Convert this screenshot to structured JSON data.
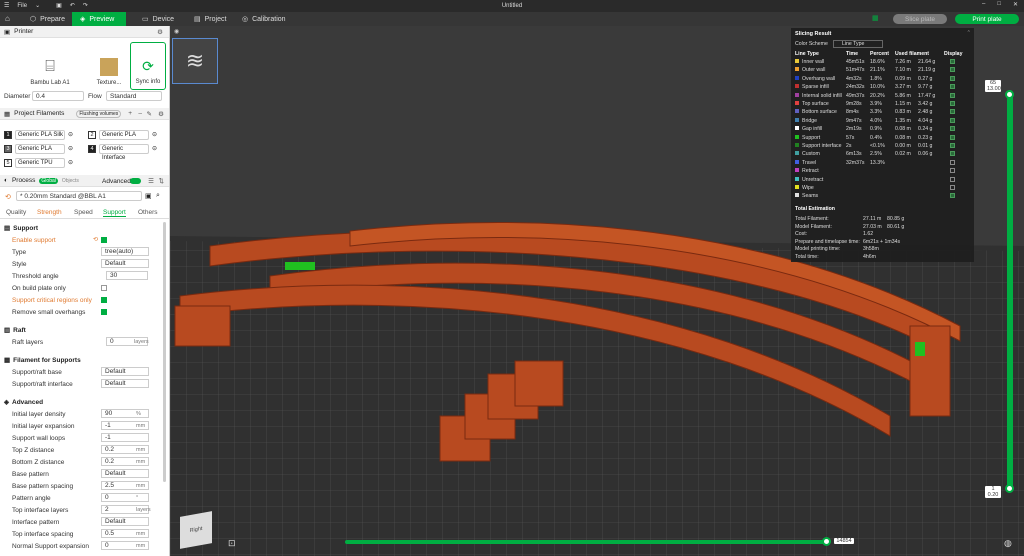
{
  "titlebar": {
    "file_menu": "File",
    "title": "Untitled"
  },
  "nav": {
    "tabs": [
      {
        "label": "Prepare"
      },
      {
        "label": "Preview"
      },
      {
        "label": "Device"
      },
      {
        "label": "Project"
      },
      {
        "label": "Calibration"
      }
    ],
    "slice_label": "Slice plate",
    "print_label": "Print plate"
  },
  "printer": {
    "section": "Printer",
    "printer_name": "Bambu Lab A1",
    "plate_label": "Texture...",
    "sync_label": "Sync info",
    "diameter_label": "Diameter",
    "diameter_value": "0.4",
    "flow_label": "Flow",
    "flow_value": "Standard"
  },
  "filaments": {
    "section": "Project Filaments",
    "flushing": "Flushing volumes",
    "items": [
      {
        "num": "1",
        "name": "Generic PLA Silk"
      },
      {
        "num": "2",
        "name": "Generic PLA"
      },
      {
        "num": "3",
        "name": "Generic PLA"
      },
      {
        "num": "4",
        "name": "Generic Interface"
      },
      {
        "num": "5",
        "name": "Generic TPU"
      }
    ]
  },
  "process": {
    "section": "Process",
    "global_label": "Global",
    "objects_label": "Objects",
    "advanced_label": "Advanced",
    "preset": "* 0.20mm Standard @BBL A1",
    "tabs": [
      "Quality",
      "Strength",
      "Speed",
      "Support",
      "Others"
    ]
  },
  "support": {
    "group": "Support",
    "enable": "Enable support",
    "type_label": "Type",
    "type_value": "tree(auto)",
    "style_label": "Style",
    "style_value": "Default",
    "threshold_label": "Threshold angle",
    "threshold_value": "30",
    "build_plate_label": "On build plate only",
    "critical_label": "Support critical regions only",
    "remove_small_label": "Remove small overhangs"
  },
  "raft": {
    "group": "Raft",
    "layers_label": "Raft layers",
    "layers_value": "0",
    "layers_unit": "layers"
  },
  "filament_for_supports": {
    "group": "Filament for Supports",
    "base_label": "Support/raft base",
    "base_value": "Default",
    "iface_label": "Support/raft interface",
    "iface_value": "Default"
  },
  "advanced": {
    "group": "Advanced",
    "rows": [
      {
        "label": "Initial layer density",
        "value": "90",
        "unit": "%"
      },
      {
        "label": "Initial layer expansion",
        "value": "-1",
        "unit": "mm"
      },
      {
        "label": "Support wall loops",
        "value": "-1",
        "unit": ""
      },
      {
        "label": "Top Z distance",
        "value": "0.2",
        "unit": "mm"
      },
      {
        "label": "Bottom Z distance",
        "value": "0.2",
        "unit": "mm"
      },
      {
        "label": "Base pattern",
        "value": "Default",
        "unit": ""
      },
      {
        "label": "Base pattern spacing",
        "value": "2.5",
        "unit": "mm"
      },
      {
        "label": "Pattern angle",
        "value": "0",
        "unit": "°"
      },
      {
        "label": "Top interface layers",
        "value": "2",
        "unit": "layers"
      },
      {
        "label": "Interface pattern",
        "value": "Default",
        "unit": ""
      },
      {
        "label": "Top interface spacing",
        "value": "0.5",
        "unit": "mm"
      },
      {
        "label": "Normal Support expansion",
        "value": "0",
        "unit": "mm"
      }
    ]
  },
  "result": {
    "title": "Slicing Result",
    "scheme_label": "Color Scheme",
    "scheme_value": "Line Type",
    "headers": [
      "Line Type",
      "Time",
      "Percent",
      "Used filament",
      "Display"
    ],
    "rows": [
      {
        "name": "Inner wall",
        "color": "#e8c83a",
        "time": "45m51s",
        "pct": "18.6%",
        "m": "7.26 m",
        "g": "21.64 g",
        "on": true
      },
      {
        "name": "Outer wall",
        "color": "#f0a030",
        "time": "51m47s",
        "pct": "21.1%",
        "m": "7.10 m",
        "g": "21.19 g",
        "on": true
      },
      {
        "name": "Overhang wall",
        "color": "#2040c0",
        "time": "4m32s",
        "pct": "1.8%",
        "m": "0.09 m",
        "g": "0.27 g",
        "on": true
      },
      {
        "name": "Sparse infill",
        "color": "#c03030",
        "time": "24m32s",
        "pct": "10.0%",
        "m": "3.27 m",
        "g": "9.77 g",
        "on": true
      },
      {
        "name": "Internal solid infill",
        "color": "#a040a0",
        "time": "49m37s",
        "pct": "20.2%",
        "m": "5.86 m",
        "g": "17.47 g",
        "on": true
      },
      {
        "name": "Top surface",
        "color": "#e04040",
        "time": "9m28s",
        "pct": "3.9%",
        "m": "1.15 m",
        "g": "3.42 g",
        "on": true
      },
      {
        "name": "Bottom surface",
        "color": "#6060c0",
        "time": "8m4s",
        "pct": "3.3%",
        "m": "0.83 m",
        "g": "2.48 g",
        "on": true
      },
      {
        "name": "Bridge",
        "color": "#4080b0",
        "time": "9m47s",
        "pct": "4.0%",
        "m": "1.35 m",
        "g": "4.04 g",
        "on": true
      },
      {
        "name": "Gap infill",
        "color": "#ffffff",
        "time": "2m19s",
        "pct": "0.9%",
        "m": "0.08 m",
        "g": "0.24 g",
        "on": true
      },
      {
        "name": "Support",
        "color": "#20c020",
        "time": "57s",
        "pct": "0.4%",
        "m": "0.08 m",
        "g": "0.23 g",
        "on": true
      },
      {
        "name": "Support interface",
        "color": "#208020",
        "time": "2s",
        "pct": "<0.1%",
        "m": "0.00 m",
        "g": "0.01 g",
        "on": true
      },
      {
        "name": "Custom",
        "color": "#40a0a0",
        "time": "6m13s",
        "pct": "2.5%",
        "m": "0.02 m",
        "g": "0.06 g",
        "on": true
      },
      {
        "name": "Travel",
        "color": "#4060e0",
        "time": "32m37s",
        "pct": "13.3%",
        "m": "",
        "g": "",
        "on": false
      },
      {
        "name": "Retract",
        "color": "#c040c0",
        "time": "",
        "pct": "",
        "m": "",
        "g": "",
        "on": false
      },
      {
        "name": "Unretract",
        "color": "#40c0c0",
        "time": "",
        "pct": "",
        "m": "",
        "g": "",
        "on": false
      },
      {
        "name": "Wipe",
        "color": "#e0e020",
        "time": "",
        "pct": "",
        "m": "",
        "g": "",
        "on": false
      },
      {
        "name": "Seams",
        "color": "#e0e0e0",
        "time": "",
        "pct": "",
        "m": "",
        "g": "",
        "on": true
      }
    ],
    "total_title": "Total Estimation",
    "totals": [
      {
        "label": "Total Filament:",
        "a": "27.11 m",
        "b": "80.85 g"
      },
      {
        "label": "Model Filament:",
        "a": "27.03 m",
        "b": "80.61 g"
      },
      {
        "label": "Cost:",
        "a": "1.62",
        "b": ""
      },
      {
        "label": "Prepare and timelapse time:",
        "a": "6m21s + 1m34s",
        "b": ""
      },
      {
        "label": "Model printing time:",
        "a": "3h58m",
        "b": ""
      },
      {
        "label": "Total time:",
        "a": "4h6m",
        "b": ""
      }
    ]
  },
  "sliders": {
    "top_layer": "65",
    "top_height": "13.00",
    "bottom_layer": "1",
    "bottom_height": "0.20",
    "move_value": "14854"
  },
  "view_cube_label": "Right",
  "colors": {
    "accent": "#00ae42",
    "print": "#b84a20"
  }
}
